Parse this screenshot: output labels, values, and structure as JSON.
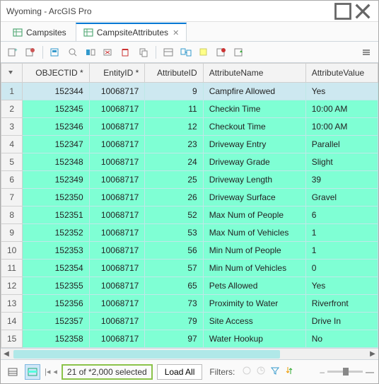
{
  "window": {
    "title": "Wyoming - ArcGIS Pro"
  },
  "tabs": [
    {
      "label": "Campsites",
      "active": false
    },
    {
      "label": "CampsiteAttributes",
      "active": true
    }
  ],
  "columns": [
    "OBJECTID *",
    "EntityID *",
    "AttributeID",
    "AttributeName",
    "AttributeValue"
  ],
  "rows": [
    {
      "n": 1,
      "oid": "152344",
      "eid": "10068717",
      "aid": "9",
      "name": "Campfire Allowed",
      "val": "Yes"
    },
    {
      "n": 2,
      "oid": "152345",
      "eid": "10068717",
      "aid": "11",
      "name": "Checkin Time",
      "val": "10:00 AM"
    },
    {
      "n": 3,
      "oid": "152346",
      "eid": "10068717",
      "aid": "12",
      "name": "Checkout Time",
      "val": "10:00 AM"
    },
    {
      "n": 4,
      "oid": "152347",
      "eid": "10068717",
      "aid": "23",
      "name": "Driveway Entry",
      "val": "Parallel"
    },
    {
      "n": 5,
      "oid": "152348",
      "eid": "10068717",
      "aid": "24",
      "name": "Driveway Grade",
      "val": "Slight"
    },
    {
      "n": 6,
      "oid": "152349",
      "eid": "10068717",
      "aid": "25",
      "name": "Driveway Length",
      "val": "39"
    },
    {
      "n": 7,
      "oid": "152350",
      "eid": "10068717",
      "aid": "26",
      "name": "Driveway Surface",
      "val": "Gravel"
    },
    {
      "n": 8,
      "oid": "152351",
      "eid": "10068717",
      "aid": "52",
      "name": "Max Num of People",
      "val": "6"
    },
    {
      "n": 9,
      "oid": "152352",
      "eid": "10068717",
      "aid": "53",
      "name": "Max Num of Vehicles",
      "val": "1"
    },
    {
      "n": 10,
      "oid": "152353",
      "eid": "10068717",
      "aid": "56",
      "name": "Min Num of People",
      "val": "1"
    },
    {
      "n": 11,
      "oid": "152354",
      "eid": "10068717",
      "aid": "57",
      "name": "Min Num of Vehicles",
      "val": "0"
    },
    {
      "n": 12,
      "oid": "152355",
      "eid": "10068717",
      "aid": "65",
      "name": "Pets Allowed",
      "val": "Yes"
    },
    {
      "n": 13,
      "oid": "152356",
      "eid": "10068717",
      "aid": "73",
      "name": "Proximity to Water",
      "val": "Riverfront"
    },
    {
      "n": 14,
      "oid": "152357",
      "eid": "10068717",
      "aid": "79",
      "name": "Site Access",
      "val": "Drive In"
    },
    {
      "n": 15,
      "oid": "152358",
      "eid": "10068717",
      "aid": "97",
      "name": "Water Hookup",
      "val": "No"
    }
  ],
  "status": {
    "selected_text": "21 of *2,000 selected",
    "load_all": "Load All",
    "filters_label": "Filters:"
  }
}
